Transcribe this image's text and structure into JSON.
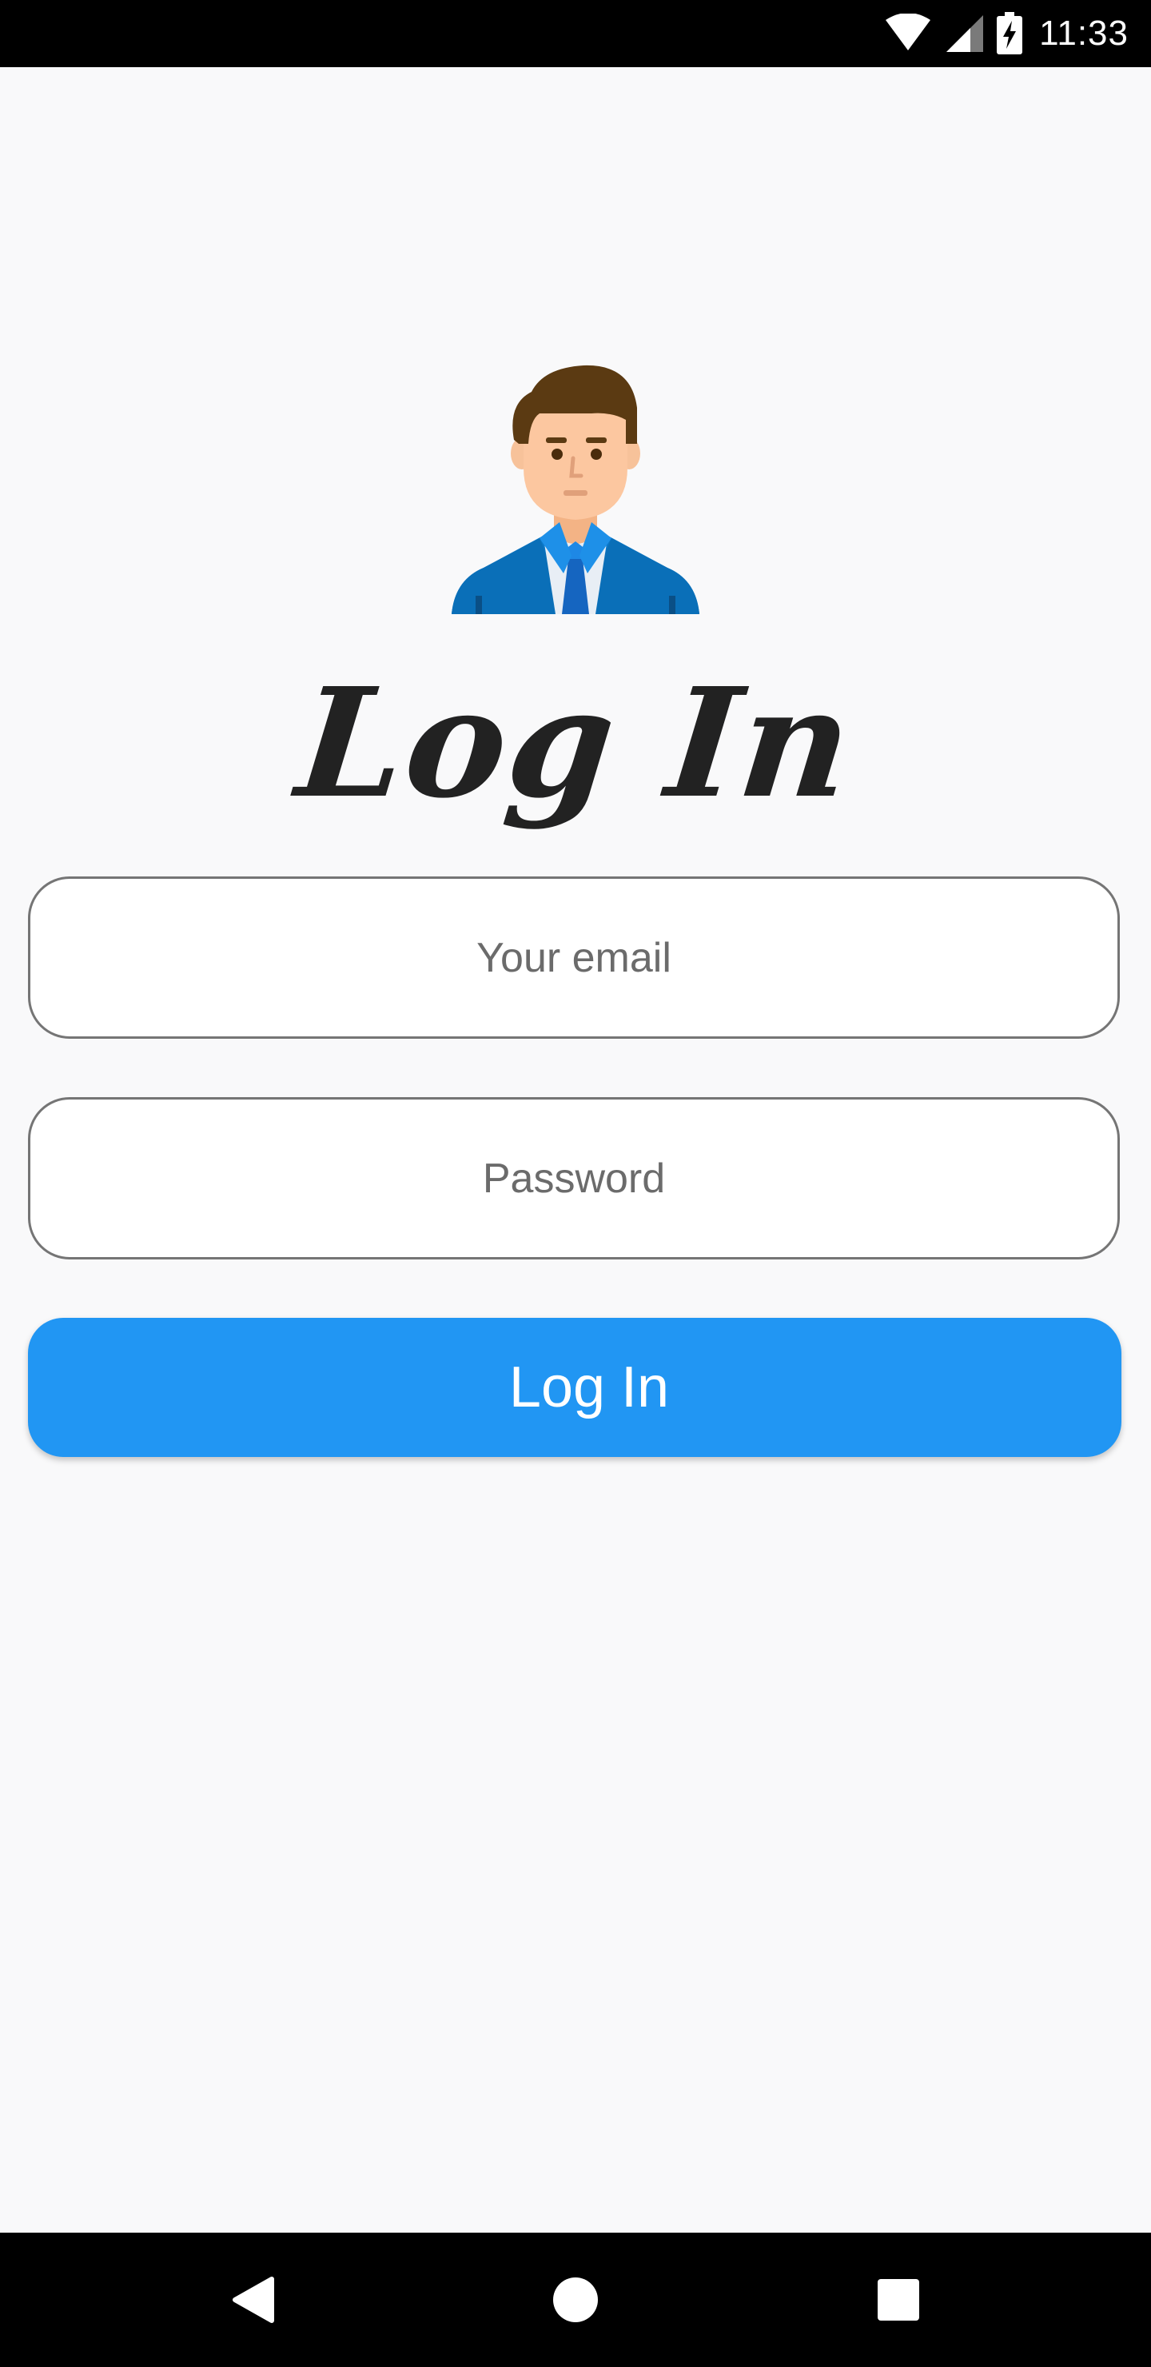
{
  "status_bar": {
    "time": "11:33",
    "icons": [
      "wifi-icon",
      "cell-signal-icon",
      "battery-charging-icon"
    ]
  },
  "login": {
    "title": "Log In",
    "email_placeholder": "Your email",
    "password_placeholder": "Password",
    "button_label": "Log In",
    "accent_color": "#2196f3"
  },
  "nav_bar": {
    "icons": [
      "back-icon",
      "home-icon",
      "recents-icon"
    ]
  }
}
